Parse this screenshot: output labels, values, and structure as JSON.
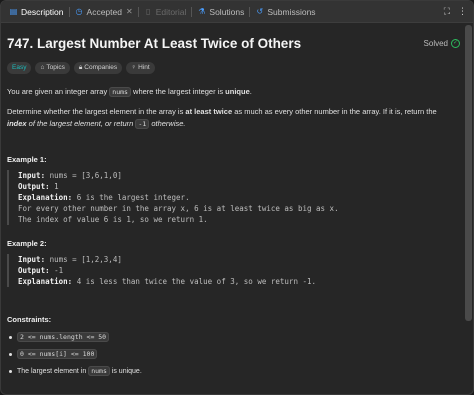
{
  "tabs": [
    {
      "label": "Description",
      "icon": "doc-icon"
    },
    {
      "label": "Accepted",
      "icon": "clock-icon"
    },
    {
      "label": "Editorial",
      "icon": "book-icon"
    },
    {
      "label": "Solutions",
      "icon": "flask-icon"
    },
    {
      "label": "Submissions",
      "icon": "history-icon"
    }
  ],
  "problem": {
    "title": "747. Largest Number At Least Twice of Others",
    "status": "Solved",
    "difficulty": "Easy",
    "chips": [
      "Topics",
      "Companies",
      "Hint"
    ]
  },
  "description": {
    "p1_a": "You are given an integer array ",
    "p1_code": "nums",
    "p1_b": " where the largest integer is ",
    "p1_bold": "unique",
    "p1_c": ".",
    "p2_a": "Determine whether the largest element in the array is ",
    "p2_bold": "at least twice",
    "p2_b": " as much as every other number in the array. If it is, return the ",
    "p2_ib": "index",
    "p2_i1": " of the largest element, or return ",
    "p2_code": "-1",
    "p2_i2": " otherwise."
  },
  "example1": {
    "heading": "Example 1:",
    "input_label": "Input:",
    "input": " nums = [3,6,1,0]",
    "output_label": "Output:",
    "output": " 1",
    "expl_label": "Explanation:",
    "expl": " 6 is the largest integer.",
    "line2": "For every other number in the array x, 6 is at least twice as big as x.",
    "line3": "The index of value 6 is 1, so we return 1."
  },
  "example2": {
    "heading": "Example 2:",
    "input_label": "Input:",
    "input": " nums = [1,2,3,4]",
    "output_label": "Output:",
    "output": " -1",
    "expl_label": "Explanation:",
    "expl": " 4 is less than twice the value of 3, so we return -1."
  },
  "constraints": {
    "heading": "Constraints:",
    "c1": "2 <= nums.length <= 50",
    "c2": "0 <= nums[i] <= 100",
    "c3_a": "The largest element in ",
    "c3_code": "nums",
    "c3_b": " is unique."
  },
  "colors": {
    "easy": "#1cbaba",
    "solved": "#2cbb5d",
    "background": "#262626"
  }
}
